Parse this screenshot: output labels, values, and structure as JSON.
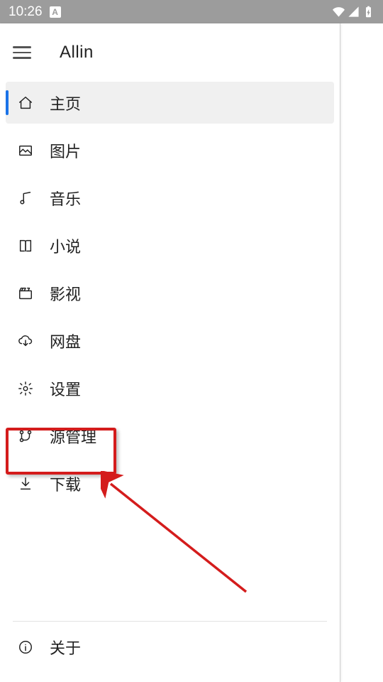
{
  "status": {
    "time": "10:26",
    "a_badge": "A"
  },
  "header": {
    "title": "Allin"
  },
  "menu": {
    "items": [
      {
        "label": "主页"
      },
      {
        "label": "图片"
      },
      {
        "label": "音乐"
      },
      {
        "label": "小说"
      },
      {
        "label": "影视"
      },
      {
        "label": "网盘"
      },
      {
        "label": "设置"
      },
      {
        "label": "源管理"
      },
      {
        "label": "下载"
      }
    ]
  },
  "bottom": {
    "about_label": "关于"
  },
  "annotation": {
    "highlighted_item": "源管理"
  }
}
